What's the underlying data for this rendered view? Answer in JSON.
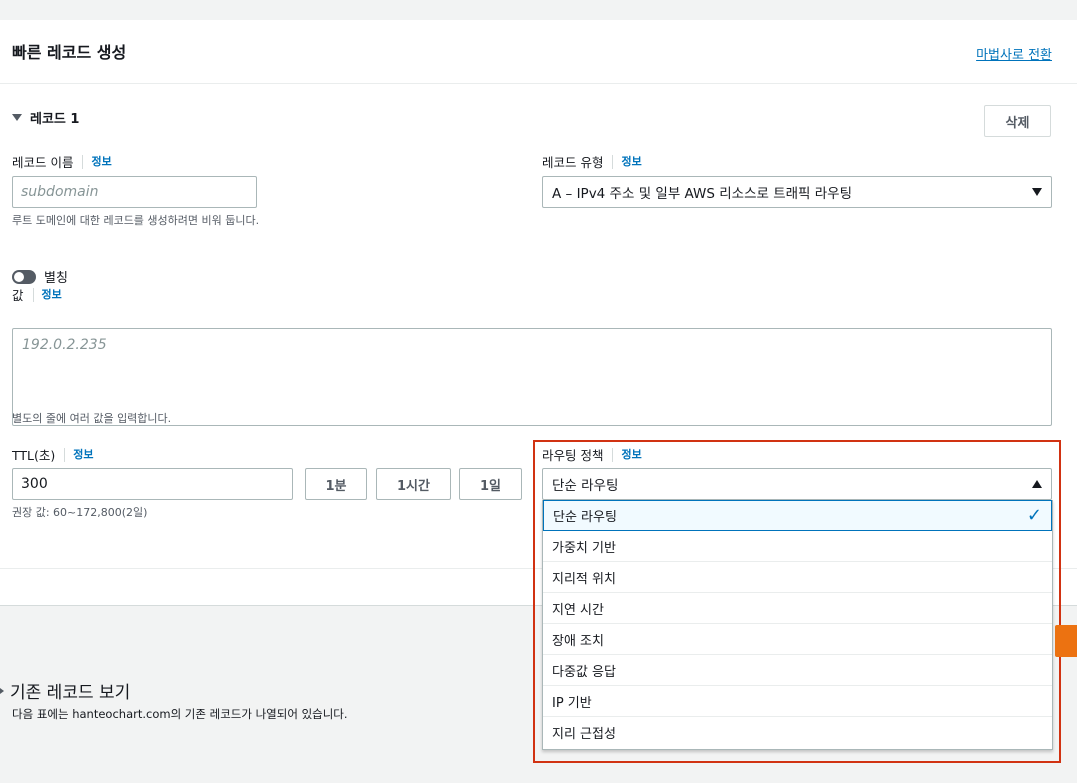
{
  "panel": {
    "title": "빠른 레코드 생성",
    "wizard_link": "마법사로 전환"
  },
  "record": {
    "toggle_label": "레코드 1",
    "delete_label": "삭제",
    "info_label": "정보",
    "name": {
      "label": "레코드 이름",
      "placeholder": "subdomain",
      "help": "루트 도메인에 대한 레코드를 생성하려면 비워 둡니다."
    },
    "type": {
      "label": "레코드 유형",
      "value": "A – IPv4 주소 및 일부 AWS 리소스로 트래픽 라우팅"
    },
    "alias": {
      "label": "별칭",
      "enabled": false
    },
    "value": {
      "label": "값",
      "placeholder": "192.0.2.235",
      "help": "별도의 줄에 여러 값을 입력합니다."
    },
    "ttl": {
      "label": "TTL(초)",
      "value": "300",
      "help": "권장 값: 60~172,800(2일)",
      "quick_buttons": [
        "1분",
        "1시간",
        "1일"
      ]
    },
    "routing": {
      "label": "라우팅 정책",
      "value": "단순 라우팅",
      "options": [
        "단순 라우팅",
        "가중치 기반",
        "지리적 위치",
        "지연 시간",
        "장애 조치",
        "다중값 응답",
        "IP 기반",
        "지리 근접성"
      ],
      "selected_index": 0
    }
  },
  "existing": {
    "title": "기존 레코드 보기",
    "description": "다음 표에는 hanteochart.com의 기존 레코드가 나열되어 있습니다."
  },
  "colors": {
    "link": "#0073bb",
    "highlight": "#d13212",
    "primary": "#ec7211"
  }
}
